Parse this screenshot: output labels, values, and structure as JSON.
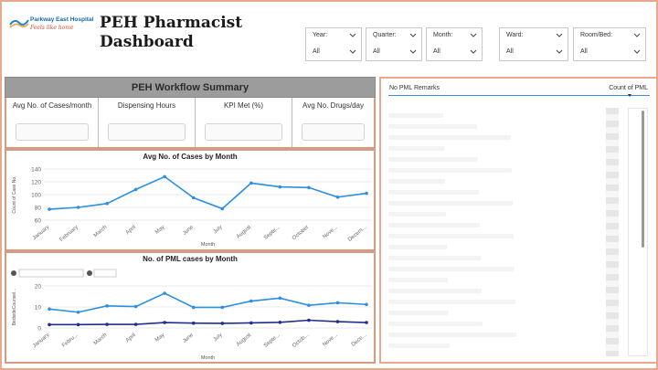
{
  "header": {
    "logo_name": "Parkway East Hospital",
    "logo_tagline": "Feels like home",
    "title_line1": "PEH Pharmacist",
    "title_line2": "Dashboard"
  },
  "slicers": [
    {
      "label": "Year:",
      "value": "All"
    },
    {
      "label": "Quarter:",
      "value": "All"
    },
    {
      "label": "Month:",
      "value": "All"
    },
    {
      "label": "Ward:",
      "value": "All"
    },
    {
      "label": "Room/Bed:",
      "value": "All"
    }
  ],
  "summary": {
    "title": "PEH Workflow Summary",
    "kpis": [
      {
        "label": "Avg No. of Cases/month"
      },
      {
        "label": "Dispensing Hours"
      },
      {
        "label": "KPI Met (%)"
      },
      {
        "label": "Avg No. Drugs/day"
      }
    ]
  },
  "table": {
    "col1": "No PML Remarks",
    "col2": "Count of PML"
  },
  "colors": {
    "accent_border": "#e8a88c",
    "line_light": "#2b8fe5",
    "line_dark": "#1f2f8a"
  },
  "chart_data": [
    {
      "type": "line",
      "title": "Avg No. of Cases by Month",
      "xlabel": "Month",
      "ylabel": "Count of Case No.",
      "categories": [
        "January",
        "February",
        "March",
        "April",
        "May",
        "June",
        "July",
        "August",
        "Septe...",
        "October",
        "Nove...",
        "Decem..."
      ],
      "ylim": [
        60,
        140
      ],
      "yticks": [
        60,
        80,
        100,
        120,
        140
      ],
      "series": [
        {
          "values": [
            77,
            80,
            86,
            108,
            128,
            95,
            78,
            118,
            112,
            111,
            96,
            102
          ]
        }
      ]
    },
    {
      "type": "line",
      "title": "No. of PML cases by Month",
      "xlabel": "Month",
      "ylabel": "BedsideCounsel...",
      "categories": [
        "January",
        "Febru...",
        "March",
        "April",
        "May",
        "June",
        "July",
        "August",
        "Septe...",
        "Octob...",
        "Nove...",
        "Dece..."
      ],
      "ylim": [
        0,
        20
      ],
      "yticks": [
        0,
        10,
        20
      ],
      "series": [
        {
          "values": [
            9,
            7.5,
            10.5,
            10.2,
            16.5,
            9.8,
            9.8,
            12.8,
            14.2,
            10.8,
            12,
            11.2
          ]
        },
        {
          "values": [
            1.6,
            1.6,
            1.7,
            1.7,
            2.6,
            2.3,
            2.2,
            2.4,
            2.7,
            3.7,
            3.0,
            2.6
          ]
        }
      ]
    }
  ]
}
